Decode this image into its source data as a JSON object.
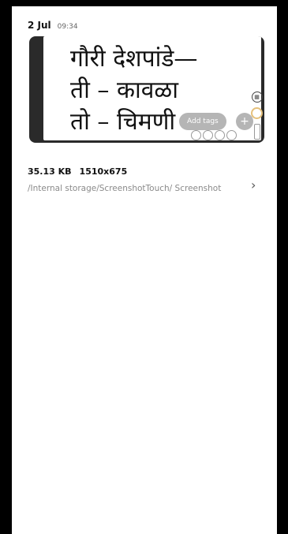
{
  "header": {
    "date": "2 Jul",
    "time": "09:34"
  },
  "image": {
    "line1": "गौरी देशपांडे—",
    "line2": "ती – कावळा",
    "line3": "तो – चिमणी",
    "add_tags_label": "Add tags",
    "plus_label": "+"
  },
  "details": {
    "size": "35.13 KB",
    "resolution": "1510x675",
    "path": "/Internal storage/ScreenshotTouch/ Screenshot",
    "chevron": "›"
  }
}
